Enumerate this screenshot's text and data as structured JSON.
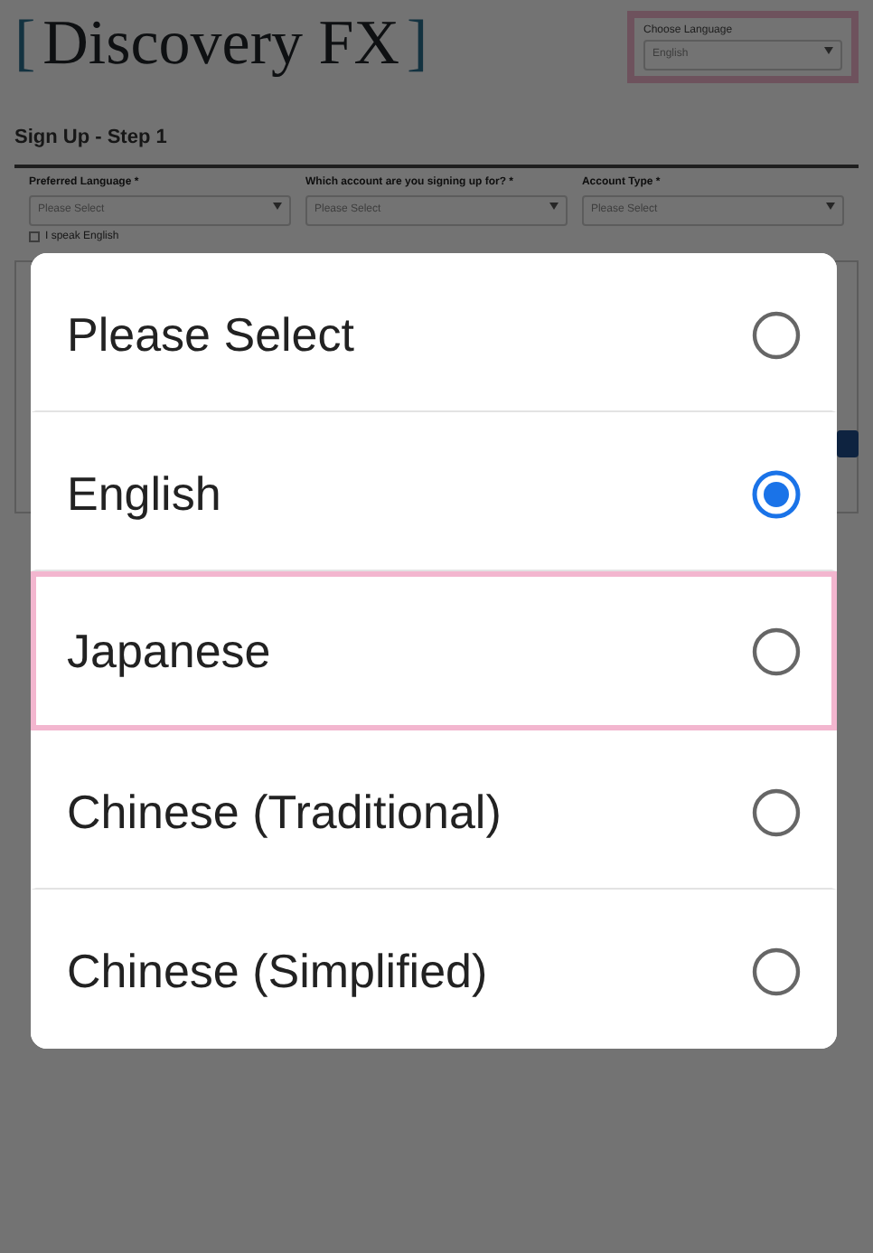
{
  "header": {
    "logo": {
      "open": "[",
      "name": "Discovery FX",
      "close": "]"
    },
    "language_picker": {
      "label": "Choose Language",
      "value": "English",
      "highlighted": true
    }
  },
  "form": {
    "title": "Sign Up - Step 1",
    "fields": [
      {
        "label": "Preferred Language *",
        "value": "Please Select"
      },
      {
        "label": "Which account are you signing up for? *",
        "value": "Please Select"
      },
      {
        "label": "Account Type *",
        "value": "Please Select"
      }
    ],
    "checkbox": {
      "label": "I speak English",
      "checked": false
    }
  },
  "dialog": {
    "options": [
      {
        "label": "Please Select",
        "selected": false,
        "highlighted": false
      },
      {
        "label": "English",
        "selected": true,
        "highlighted": false
      },
      {
        "label": "Japanese",
        "selected": false,
        "highlighted": true
      },
      {
        "label": "Chinese (Traditional)",
        "selected": false,
        "highlighted": false
      },
      {
        "label": "Chinese (Simplified)",
        "selected": false,
        "highlighted": false
      }
    ]
  }
}
